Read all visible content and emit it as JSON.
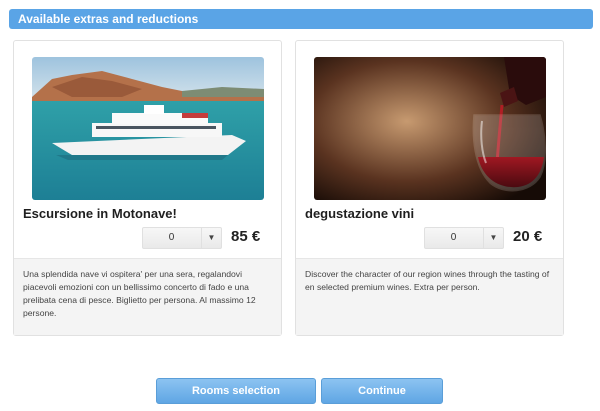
{
  "header": {
    "title": "Available extras and reductions"
  },
  "extras": [
    {
      "title": "Escursione in Motonave!",
      "quantity": "0",
      "price": "85 €",
      "description": "Una splendida nave vi ospitera' per una sera, regalandovi piacevoli emozioni con un bellissimo concerto di fado e una prelibata cena di pesce. Biglietto per persona. Al massimo 12 persone."
    },
    {
      "title": "degustazione vini",
      "quantity": "0",
      "price": "20 €",
      "description": "Discover the character of our region wines through the tasting of en selected premium wines. Extra per person."
    }
  ],
  "buttons": {
    "rooms_selection": "Rooms selection",
    "continue": "Continue"
  },
  "colors": {
    "accent": "#5aa4e6",
    "button": "#6eb0ea"
  }
}
